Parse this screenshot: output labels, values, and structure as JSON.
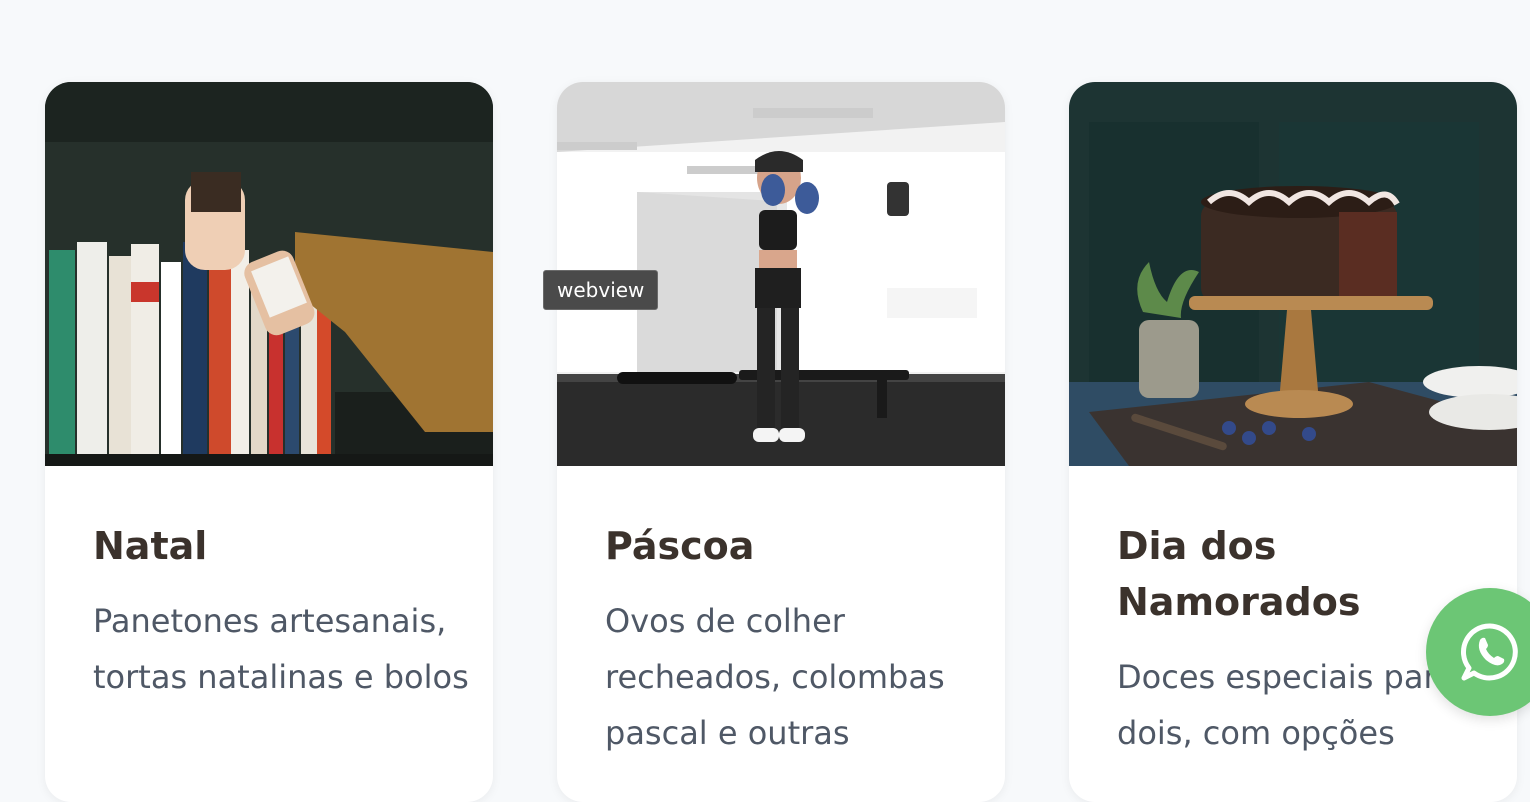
{
  "cards": [
    {
      "title": "Natal",
      "description": "Panetones artesanais, tortas natalinas e bolos",
      "image": "bookshelf-photo"
    },
    {
      "title": "Páscoa",
      "description": "Ovos de colher recheados, colombas pascal e outras",
      "image": "boxing-gym-photo"
    },
    {
      "title": "Dia dos Namorados",
      "description": "Doces especiais para dois, com opções",
      "image": "chocolate-cake-photo"
    }
  ],
  "tooltip": {
    "text": "webview"
  },
  "whatsapp": {
    "icon": "whatsapp-icon",
    "color": "#6cc675"
  },
  "colors": {
    "background": "#f7f9fb",
    "title": "#3b322c",
    "text": "#4f5866"
  }
}
